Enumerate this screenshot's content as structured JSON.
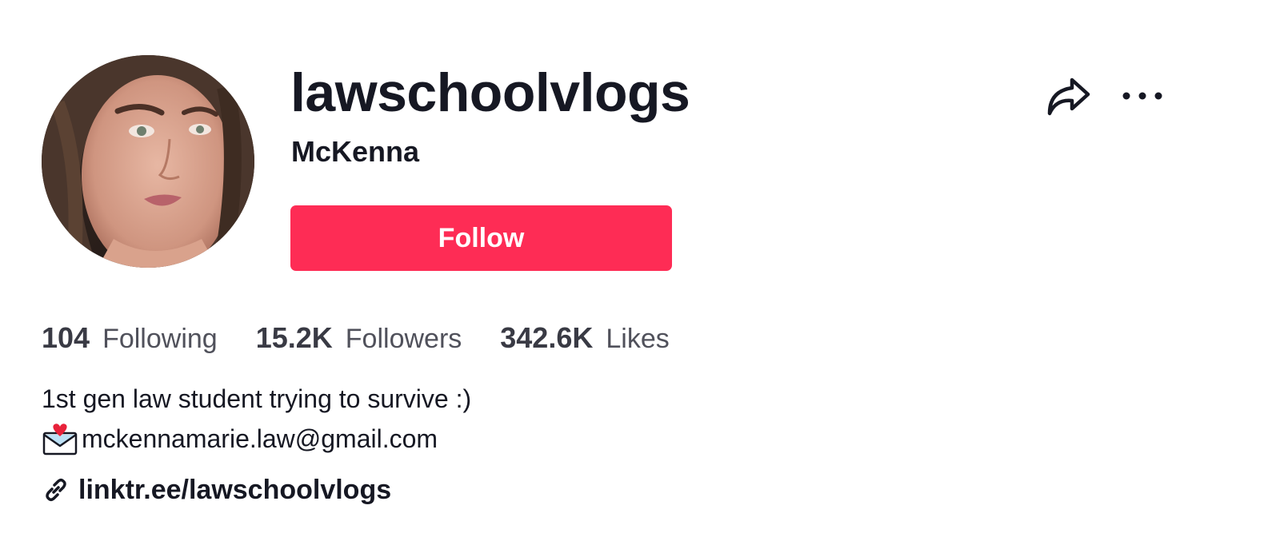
{
  "profile": {
    "username": "lawschoolvlogs",
    "nickname": "McKenna",
    "follow_label": "Follow",
    "avatar": "profile-photo"
  },
  "stats": [
    {
      "value": "104",
      "label": "Following"
    },
    {
      "value": "15.2K",
      "label": "Followers"
    },
    {
      "value": "342.6K",
      "label": "Likes"
    }
  ],
  "bio": {
    "line1": "1st gen law student trying to survive :)",
    "line2_icon": "love-letter-emoji",
    "line2": "mckennamarie.law@gmail.com"
  },
  "link": {
    "icon": "link-icon",
    "text": "linktr.ee/lawschoolvlogs"
  },
  "actions": {
    "share_icon": "share-icon",
    "more_icon": "more-icon"
  },
  "colors": {
    "accent": "#fe2c55",
    "text": "#161823",
    "stat_number": "#393a44",
    "stat_label": "#50515b"
  }
}
